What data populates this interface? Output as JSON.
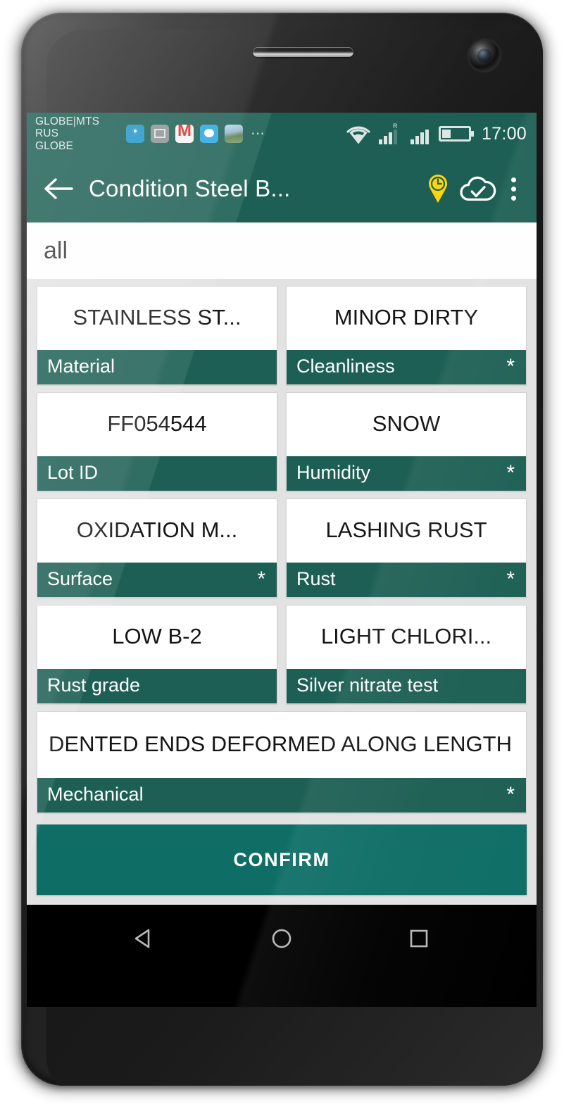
{
  "status_bar": {
    "carrier": "GLOBE|MTS RUS\nGLOBE",
    "time": "17:00",
    "notification_icons": [
      "maps-pin-icon",
      "photo-icon",
      "gmail-icon",
      "chat-icon",
      "photo-thumbnail-icon",
      "more-notifications-icon"
    ],
    "signal_roaming_label": "R",
    "right_icons": [
      "wifi-icon",
      "signal-sim1-icon",
      "signal-sim2-icon",
      "battery-icon"
    ]
  },
  "app_bar": {
    "back_label": "←",
    "title": "Condition Steel B...",
    "actions": [
      "location-pin-icon",
      "cloud-check-icon",
      "overflow-menu-icon"
    ]
  },
  "filter_bar": {
    "text": "all"
  },
  "cards": [
    {
      "value": "STAINLESS ST...",
      "label": "Material",
      "required": false,
      "width": "half"
    },
    {
      "value": "MINOR DIRTY",
      "label": "Cleanliness",
      "required": true,
      "width": "half"
    },
    {
      "value": "FF054544",
      "label": "Lot ID",
      "required": false,
      "width": "half"
    },
    {
      "value": "SNOW",
      "label": "Humidity",
      "required": true,
      "width": "half"
    },
    {
      "value": "OXIDATION M...",
      "label": "Surface",
      "required": true,
      "width": "half"
    },
    {
      "value": "LASHING RUST",
      "label": "Rust",
      "required": true,
      "width": "half"
    },
    {
      "value": "LOW B-2",
      "label": "Rust grade",
      "required": false,
      "width": "half"
    },
    {
      "value": "LIGHT CHLORI...",
      "label": "Silver nitrate test",
      "required": false,
      "width": "half"
    },
    {
      "value": "DENTED ENDS DEFORMED ALONG LENGTH",
      "label": "Mechanical",
      "required": true,
      "width": "full"
    }
  ],
  "required_marker": "*",
  "confirm_button": {
    "label": "CONFIRM"
  },
  "nav_bar": {
    "buttons": [
      "back-nav-icon",
      "home-nav-icon",
      "recents-nav-icon"
    ]
  },
  "colors": {
    "primary_teal": "#1d5f54",
    "confirm_teal": "#0e6e66",
    "accent_yellow": "#ffd60a",
    "background_gray": "#e2e2e2",
    "card_white": "#ffffff"
  }
}
